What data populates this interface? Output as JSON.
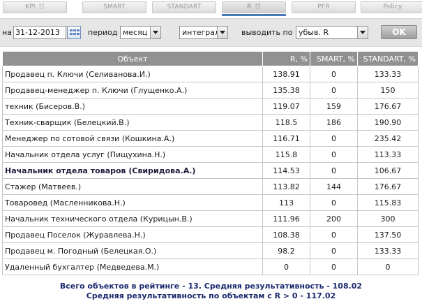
{
  "tabs": [
    {
      "label": "KPI",
      "icon": "grid-icon",
      "active": false
    },
    {
      "label": "SMART",
      "active": false
    },
    {
      "label": "STANDART",
      "active": false
    },
    {
      "label": "R",
      "icon": "grid-icon",
      "active": true
    },
    {
      "label": "PFR",
      "active": false
    },
    {
      "label": "Policy",
      "active": false
    }
  ],
  "filters": {
    "date_label": "на",
    "date_value": "31-12-2013",
    "period_label": "период",
    "period_value": "месяц",
    "mode_value": "интеграл",
    "output_label": "выводить по",
    "order_value": "убыв. R",
    "ok_label": "OK"
  },
  "table": {
    "headers": [
      "Объект",
      "R, %",
      "SMART, %",
      "STANDART, %"
    ],
    "rows": [
      {
        "name": "Продавец п. Ключи (Селиванова.И.)",
        "r": "138.91",
        "smart": "0",
        "standart": "133.33",
        "bold": false
      },
      {
        "name": "Продавец-менеджер п. Ключи (Глущенко.А.)",
        "r": "135.38",
        "smart": "0",
        "standart": "150",
        "bold": false
      },
      {
        "name": "техник (Бисеров.В.)",
        "r": "119.07",
        "smart": "159",
        "standart": "176.67",
        "bold": false
      },
      {
        "name": "Техник-сварщик (Белецкий.В.)",
        "r": "118.5",
        "smart": "186",
        "standart": "190.90",
        "bold": false
      },
      {
        "name": "Менеджер по сотовой связи (Кошкина.А.)",
        "r": "116.71",
        "smart": "0",
        "standart": "235.42",
        "bold": false
      },
      {
        "name": "Начальник отдела услуг (Пищухина.Н.)",
        "r": "115.8",
        "smart": "0",
        "standart": "113.33",
        "bold": false
      },
      {
        "name": "Начальник отдела товаров (Свиридова.А.)",
        "r": "114.53",
        "smart": "0",
        "standart": "106.67",
        "bold": true
      },
      {
        "name": "Стажер (Матвеев.)",
        "r": "113.82",
        "smart": "144",
        "standart": "176.67",
        "bold": false
      },
      {
        "name": "Товаровед (Масленникова.Н.)",
        "r": "113",
        "smart": "0",
        "standart": "115.83",
        "bold": false
      },
      {
        "name": "Начальник технического отдела (Курицын.В.)",
        "r": "111.96",
        "smart": "200",
        "standart": "300",
        "bold": false
      },
      {
        "name": "Продавец Поселок (Журавлева.Н.)",
        "r": "108.38",
        "smart": "0",
        "standart": "137.50",
        "bold": false
      },
      {
        "name": "Продавец м. Погодный (Белецкая.О.)",
        "r": "98.2",
        "smart": "0",
        "standart": "133.33",
        "bold": false
      },
      {
        "name": "Удаленный бухгалтер (Медведева.М.)",
        "r": "0",
        "smart": "0",
        "standart": "0",
        "bold": false
      }
    ]
  },
  "summary": {
    "line1": "Всего объектов в рейтинге - 13. Средняя результативность - 108.02",
    "line2": "Средняя результативность по объектам с R > 0 - 117.02"
  },
  "colors": {
    "header_bg": "#919191",
    "summary_text": "#1b2a6e",
    "active_tab_underline": "#4a7ab5"
  }
}
